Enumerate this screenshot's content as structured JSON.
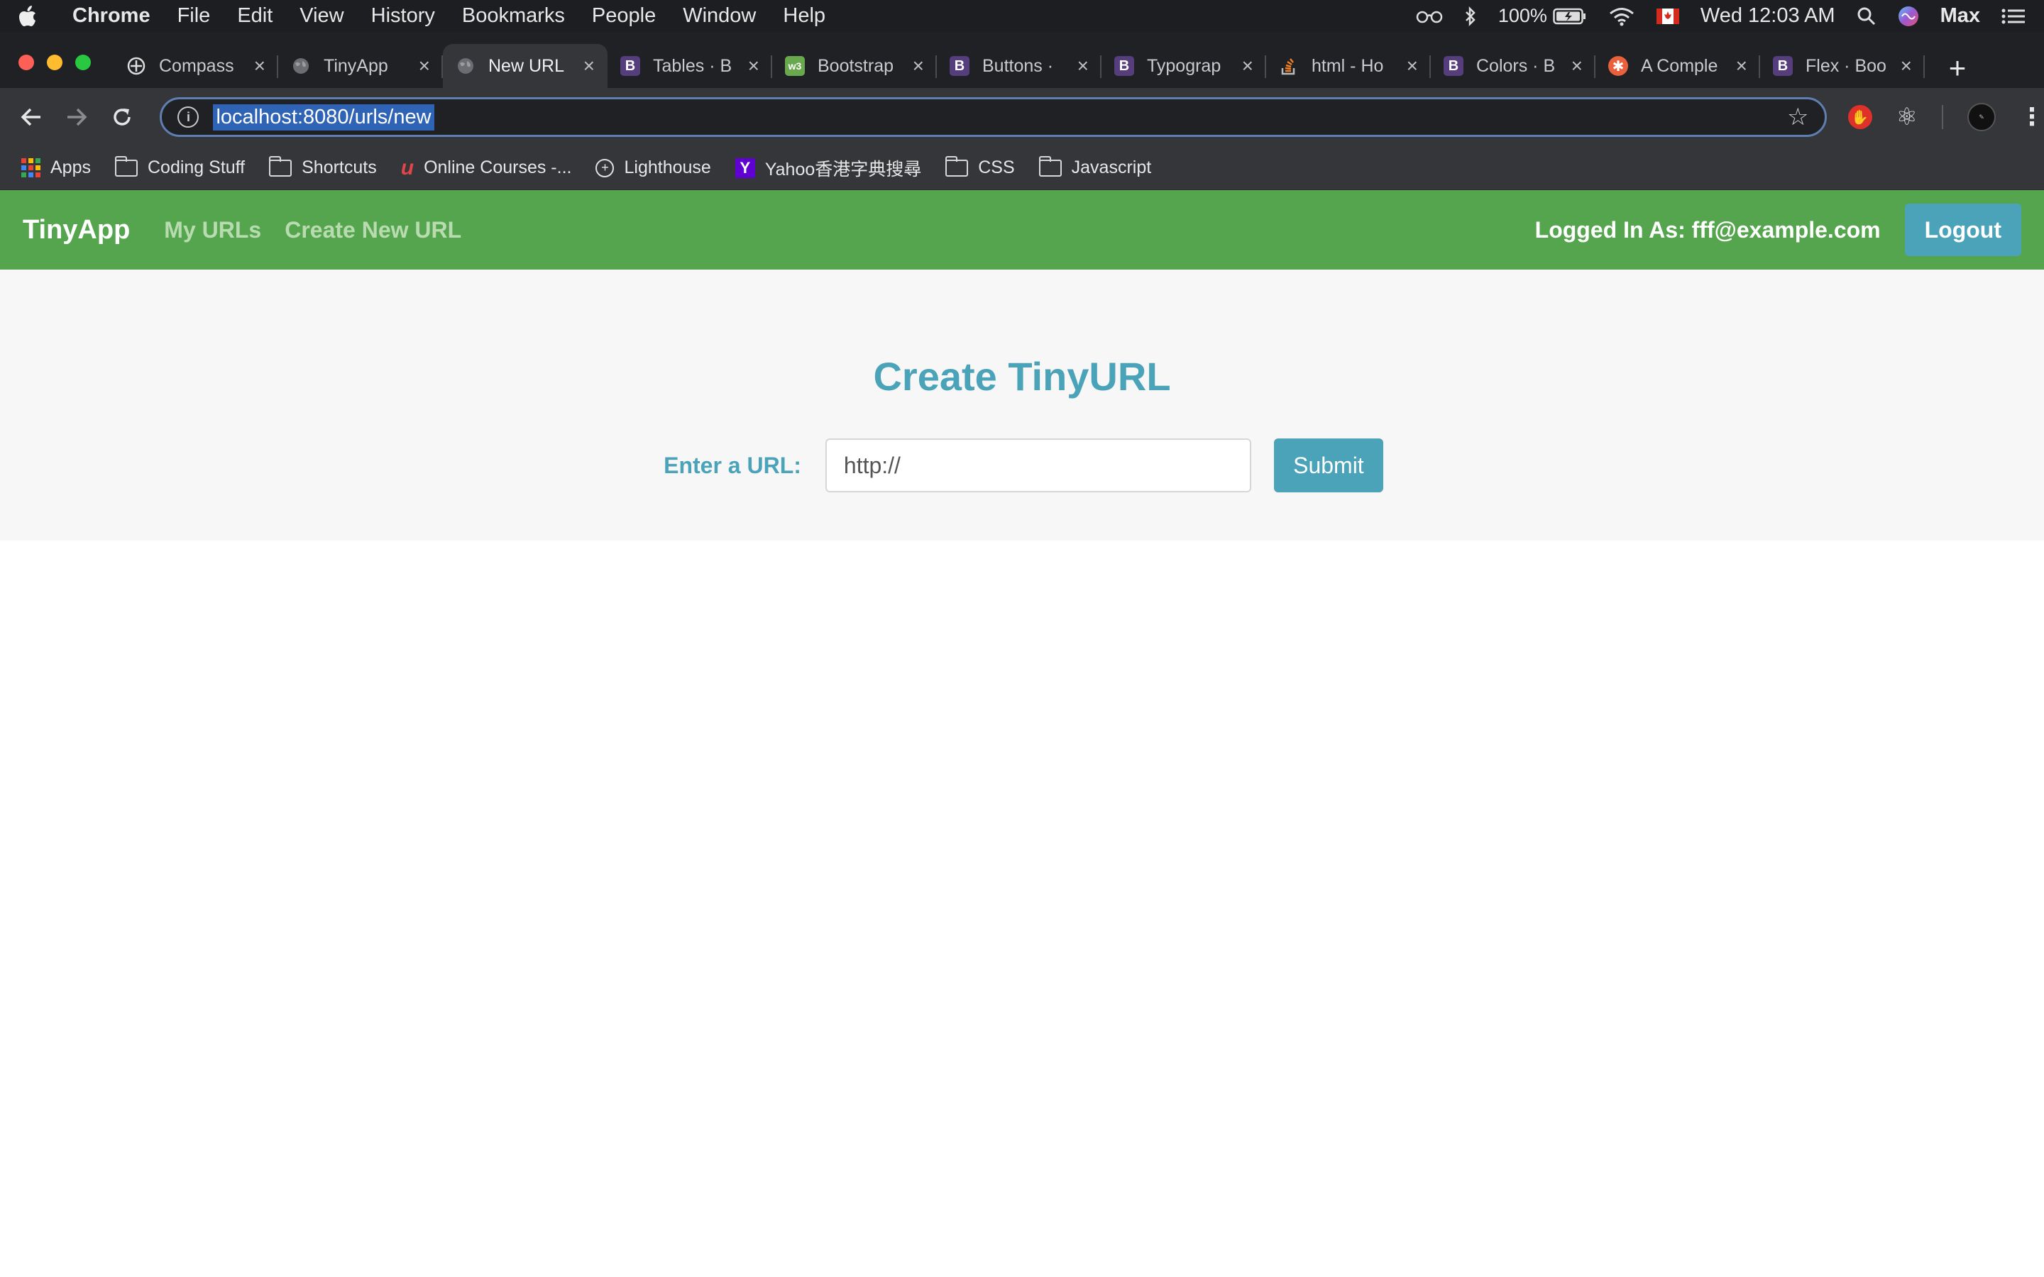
{
  "menubar": {
    "app_name": "Chrome",
    "items": [
      "File",
      "Edit",
      "View",
      "History",
      "Bookmarks",
      "People",
      "Window",
      "Help"
    ],
    "battery": "100%",
    "clock": "Wed 12:03 AM",
    "user": "Max"
  },
  "tabs": [
    {
      "title": "Compass",
      "icon": "compass-icon"
    },
    {
      "title": "TinyApp",
      "icon": "globe-icon"
    },
    {
      "title": "New URL",
      "icon": "globe-icon",
      "active": true
    },
    {
      "title": "Tables · B",
      "icon": "bootstrap-icon"
    },
    {
      "title": "Bootstrap",
      "icon": "bootstrap-green-icon"
    },
    {
      "title": "Buttons ·",
      "icon": "bootstrap-icon"
    },
    {
      "title": "Typograp",
      "icon": "bootstrap-icon"
    },
    {
      "title": "html - Ho",
      "icon": "stackoverflow-icon"
    },
    {
      "title": "Colors · B",
      "icon": "bootstrap-icon"
    },
    {
      "title": "A Comple",
      "icon": "css-tricks-icon"
    },
    {
      "title": "Flex · Boo",
      "icon": "bootstrap-icon"
    }
  ],
  "omnibox": {
    "url": "localhost:8080/urls/new"
  },
  "bookmarks": {
    "apps": "Apps",
    "coding_stuff": "Coding Stuff",
    "shortcuts": "Shortcuts",
    "online_courses": "Online Courses -...",
    "lighthouse": "Lighthouse",
    "yahoo": "Yahoo香港字典搜尋",
    "css": "CSS",
    "javascript": "Javascript"
  },
  "appnav": {
    "brand": "TinyApp",
    "my_urls": "My URLs",
    "create_new": "Create New URL",
    "logged_in": "Logged In As: fff@example.com",
    "logout": "Logout"
  },
  "form": {
    "heading": "Create TinyURL",
    "label": "Enter a URL:",
    "placeholder": "http://",
    "submit": "Submit"
  },
  "colors": {
    "nav_green": "#55a54f",
    "accent_teal": "#4aa3b9",
    "muted_link": "#b8dcb0"
  }
}
